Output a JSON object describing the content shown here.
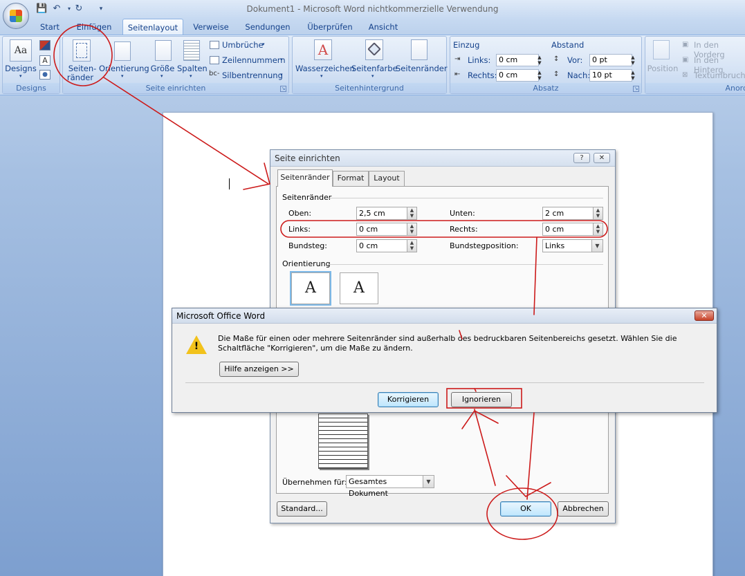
{
  "window": {
    "title": "Dokument1 - Microsoft Word nichtkommerzielle Verwendung"
  },
  "tabs": [
    "Start",
    "Einfügen",
    "Seitenlayout",
    "Verweise",
    "Sendungen",
    "Überprüfen",
    "Ansicht"
  ],
  "active_tab": "Seitenlayout",
  "ribbon": {
    "designs": {
      "button": "Designs",
      "group_label": "Designs"
    },
    "seite_einrichten": {
      "seitenraender_line1": "Seiten-",
      "seitenraender_line2": "ränder",
      "orientierung": "Orientierung",
      "groesse": "Größe",
      "spalten": "Spalten",
      "umbrueche": "Umbrüche",
      "zeilennummern": "Zeilennummern",
      "silbentrennung": "Silbentrennung",
      "group_label": "Seite einrichten"
    },
    "seitenhintergrund": {
      "wasserzeichen": "Wasserzeichen",
      "seitenfarbe": "Seitenfarbe",
      "seitenraender": "Seitenränder",
      "group_label": "Seitenhintergrund"
    },
    "absatz": {
      "einzug": "Einzug",
      "links_label": "Links:",
      "links_value": "0 cm",
      "rechts_label": "Rechts:",
      "rechts_value": "0 cm",
      "abstand": "Abstand",
      "vor_label": "Vor:",
      "vor_value": "0 pt",
      "nach_label": "Nach:",
      "nach_value": "10 pt",
      "group_label": "Absatz"
    },
    "anordnen": {
      "position": "Position",
      "vordergrund": "In den Vorderg",
      "hintergrund": "In den Hinterg",
      "textumbruch": "Textumbruch",
      "group_label": "Anord"
    }
  },
  "page_setup": {
    "title": "Seite einrichten",
    "help": "?",
    "close": "✕",
    "tabs": [
      "Seitenränder",
      "Format",
      "Layout"
    ],
    "section_margins": "Seitenränder",
    "oben_label": "Oben:",
    "oben_value": "2,5 cm",
    "unten_label": "Unten:",
    "unten_value": "2 cm",
    "links_label": "Links:",
    "links_value": "0 cm",
    "rechts_label": "Rechts:",
    "rechts_value": "0 cm",
    "bundsteg_label": "Bundsteg:",
    "bundsteg_value": "0 cm",
    "bundstegposition_label": "Bundstegposition:",
    "bundstegposition_value": "Links",
    "section_orientation": "Orientierung",
    "orientation_glyph": "A",
    "apply_label": "Übernehmen für:",
    "apply_value": "Gesamtes Dokument",
    "standard_button": "Standard...",
    "ok_button": "OK",
    "cancel_button": "Abbrechen"
  },
  "message_box": {
    "title": "Microsoft Office Word",
    "close": "✕",
    "icon": "warning-icon",
    "text": "Die Maße für einen oder mehrere Seitenränder sind außerhalb des bedruckbaren Seitenbereichs gesetzt. Wählen Sie die Schaltfläche \"Korrigieren\", um die Maße zu ändern.",
    "help_button": "Hilfe anzeigen >>",
    "fix_button": "Korrigieren",
    "ignore_button": "Ignorieren"
  },
  "colors": {
    "annotation": "#cc1a1a",
    "ribbon_text": "#15428b",
    "accent": "#3e6aaa"
  }
}
